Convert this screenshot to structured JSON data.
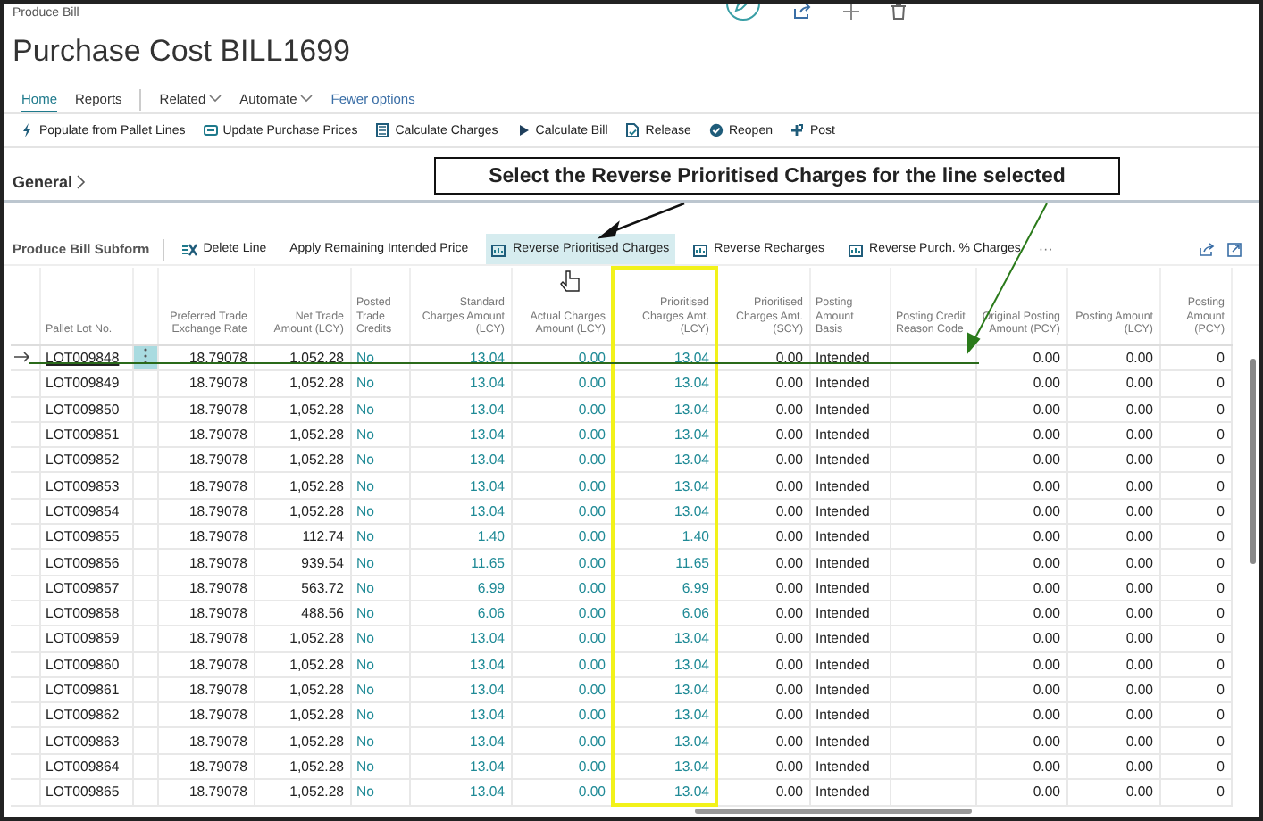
{
  "page": {
    "breadcrumb": "Produce Bill",
    "title": "Purchase Cost BILL1699"
  },
  "tabs": [
    {
      "label": "Home",
      "selected": true,
      "kind": "tab"
    },
    {
      "label": "Reports",
      "selected": false,
      "kind": "tab"
    },
    {
      "label": "Related",
      "selected": false,
      "kind": "menu"
    },
    {
      "label": "Automate",
      "selected": false,
      "kind": "menu"
    },
    {
      "label": "Fewer options",
      "selected": false,
      "kind": "link"
    }
  ],
  "actions": [
    {
      "label": "Populate from Pallet Lines"
    },
    {
      "label": "Update Purchase Prices"
    },
    {
      "label": "Calculate Charges"
    },
    {
      "label": "Calculate Bill"
    },
    {
      "label": "Release"
    },
    {
      "label": "Reopen"
    },
    {
      "label": "Post"
    }
  ],
  "general": {
    "label": "General"
  },
  "subform": {
    "title": "Produce Bill Subform",
    "more": "···",
    "actions": [
      {
        "label": "Delete Line",
        "selected": false
      },
      {
        "label": "Apply Remaining Intended Price",
        "selected": false
      },
      {
        "label": "Reverse Prioritised Charges",
        "selected": true
      },
      {
        "label": "Reverse Recharges",
        "selected": false
      },
      {
        "label": "Reverse Purch. % Charges",
        "selected": false
      }
    ]
  },
  "table": {
    "columns": [
      {
        "label": "Pallet Lot No.",
        "highlighted": false
      },
      {
        "label": "Preferred Trade Exchange Rate",
        "highlighted": false
      },
      {
        "label": "Net Trade Amount (LCY)",
        "highlighted": false
      },
      {
        "label": "Posted Trade Credits",
        "highlighted": false
      },
      {
        "label": "Standard Charges Amount (LCY)",
        "highlighted": false
      },
      {
        "label": "Actual Charges Amount (LCY)",
        "highlighted": false
      },
      {
        "label": "Prioritised Charges Amt. (LCY)",
        "highlighted": true
      },
      {
        "label": "Prioritised Charges Amt. (SCY)",
        "highlighted": false
      },
      {
        "label": "Posting Amount Basis",
        "highlighted": false
      },
      {
        "label": "Posting Credit Reason Code",
        "highlighted": false
      },
      {
        "label": "Original Posting Amount (PCY)",
        "highlighted": false
      },
      {
        "label": "Posting Amount (LCY)",
        "highlighted": false
      },
      {
        "label": "Posting Amount (PCY)",
        "highlighted": false
      }
    ],
    "rows": [
      {
        "selected": true,
        "cells": [
          "LOT009848",
          "18.79078",
          "1,052.28",
          "No",
          "13.04",
          "0.00",
          "13.04",
          "0.00",
          "Intended",
          null,
          "0.00",
          "0.00",
          "0"
        ]
      },
      {
        "selected": false,
        "cells": [
          "LOT009849",
          "18.79078",
          "1,052.28",
          "No",
          "13.04",
          "0.00",
          "13.04",
          "0.00",
          "Intended",
          null,
          "0.00",
          "0.00",
          "0"
        ]
      },
      {
        "selected": false,
        "cells": [
          "LOT009850",
          "18.79078",
          "1,052.28",
          "No",
          "13.04",
          "0.00",
          "13.04",
          "0.00",
          "Intended",
          null,
          "0.00",
          "0.00",
          "0"
        ]
      },
      {
        "selected": false,
        "cells": [
          "LOT009851",
          "18.79078",
          "1,052.28",
          "No",
          "13.04",
          "0.00",
          "13.04",
          "0.00",
          "Intended",
          null,
          "0.00",
          "0.00",
          "0"
        ]
      },
      {
        "selected": false,
        "cells": [
          "LOT009852",
          "18.79078",
          "1,052.28",
          "No",
          "13.04",
          "0.00",
          "13.04",
          "0.00",
          "Intended",
          null,
          "0.00",
          "0.00",
          "0"
        ]
      },
      {
        "selected": false,
        "cells": [
          "LOT009853",
          "18.79078",
          "1,052.28",
          "No",
          "13.04",
          "0.00",
          "13.04",
          "0.00",
          "Intended",
          null,
          "0.00",
          "0.00",
          "0"
        ]
      },
      {
        "selected": false,
        "cells": [
          "LOT009854",
          "18.79078",
          "1,052.28",
          "No",
          "13.04",
          "0.00",
          "13.04",
          "0.00",
          "Intended",
          null,
          "0.00",
          "0.00",
          "0"
        ]
      },
      {
        "selected": false,
        "cells": [
          "LOT009855",
          "18.79078",
          "112.74",
          "No",
          "1.40",
          "0.00",
          "1.40",
          "0.00",
          "Intended",
          null,
          "0.00",
          "0.00",
          "0"
        ]
      },
      {
        "selected": false,
        "cells": [
          "LOT009856",
          "18.79078",
          "939.54",
          "No",
          "11.65",
          "0.00",
          "11.65",
          "0.00",
          "Intended",
          null,
          "0.00",
          "0.00",
          "0"
        ]
      },
      {
        "selected": false,
        "cells": [
          "LOT009857",
          "18.79078",
          "563.72",
          "No",
          "6.99",
          "0.00",
          "6.99",
          "0.00",
          "Intended",
          null,
          "0.00",
          "0.00",
          "0"
        ]
      },
      {
        "selected": false,
        "cells": [
          "LOT009858",
          "18.79078",
          "488.56",
          "No",
          "6.06",
          "0.00",
          "6.06",
          "0.00",
          "Intended",
          null,
          "0.00",
          "0.00",
          "0"
        ]
      },
      {
        "selected": false,
        "cells": [
          "LOT009859",
          "18.79078",
          "1,052.28",
          "No",
          "13.04",
          "0.00",
          "13.04",
          "0.00",
          "Intended",
          null,
          "0.00",
          "0.00",
          "0"
        ]
      },
      {
        "selected": false,
        "cells": [
          "LOT009860",
          "18.79078",
          "1,052.28",
          "No",
          "13.04",
          "0.00",
          "13.04",
          "0.00",
          "Intended",
          null,
          "0.00",
          "0.00",
          "0"
        ]
      },
      {
        "selected": false,
        "cells": [
          "LOT009861",
          "18.79078",
          "1,052.28",
          "No",
          "13.04",
          "0.00",
          "13.04",
          "0.00",
          "Intended",
          null,
          "0.00",
          "0.00",
          "0"
        ]
      },
      {
        "selected": false,
        "cells": [
          "LOT009862",
          "18.79078",
          "1,052.28",
          "No",
          "13.04",
          "0.00",
          "13.04",
          "0.00",
          "Intended",
          null,
          "0.00",
          "0.00",
          "0"
        ]
      },
      {
        "selected": false,
        "cells": [
          "LOT009863",
          "18.79078",
          "1,052.28",
          "No",
          "13.04",
          "0.00",
          "13.04",
          "0.00",
          "Intended",
          null,
          "0.00",
          "0.00",
          "0"
        ]
      },
      {
        "selected": false,
        "cells": [
          "LOT009864",
          "18.79078",
          "1,052.28",
          "No",
          "13.04",
          "0.00",
          "13.04",
          "0.00",
          "Intended",
          null,
          "0.00",
          "0.00",
          "0"
        ]
      },
      {
        "selected": false,
        "cells": [
          "LOT009865",
          "18.79078",
          "1,052.28",
          "No",
          "13.04",
          "0.00",
          "13.04",
          "0.00",
          "Intended",
          null,
          "0.00",
          "0.00",
          "0"
        ]
      }
    ]
  },
  "annotation": {
    "callout": "Select the Reverse Prioritised Charges for the line selected"
  }
}
